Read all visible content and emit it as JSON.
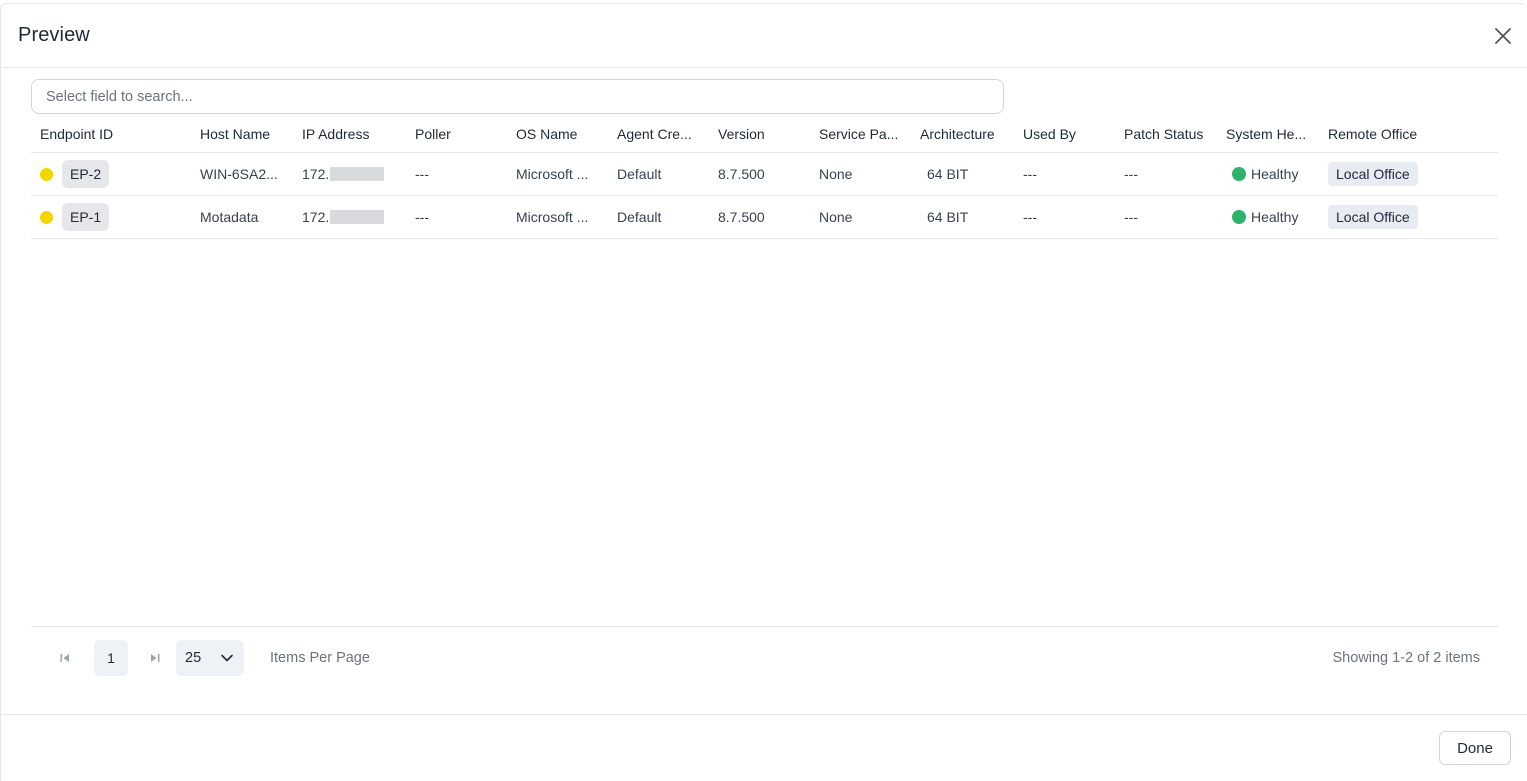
{
  "modal": {
    "title": "Preview",
    "close_icon": "close-icon"
  },
  "search": {
    "placeholder": "Select field to search..."
  },
  "table": {
    "columns": [
      "Endpoint ID",
      "Host Name",
      "IP Address",
      "Poller",
      "OS Name",
      "Agent Cre...",
      "Version",
      "Service Pa...",
      "Architecture",
      "Used By",
      "Patch Status",
      "System He...",
      "Remote Office"
    ],
    "rows": [
      {
        "endpoint_id": "EP-2",
        "status_color": "#f5d500",
        "host_name": "WIN-6SA2...",
        "ip_address": "172.",
        "poller": "---",
        "os_name": "Microsoft ...",
        "agent_cred": "Default",
        "version": "8.7.500",
        "service_pack": "None",
        "architecture": "64 BIT",
        "used_by": "---",
        "patch_status": "---",
        "system_health": "Healthy",
        "remote_office": "Local Office"
      },
      {
        "endpoint_id": "EP-1",
        "status_color": "#f5d500",
        "host_name": "Motadata",
        "ip_address": "172.",
        "poller": "---",
        "os_name": "Microsoft ...",
        "agent_cred": "Default",
        "version": "8.7.500",
        "service_pack": "None",
        "architecture": "64 BIT",
        "used_by": "---",
        "patch_status": "---",
        "system_health": "Healthy",
        "remote_office": "Local Office"
      }
    ]
  },
  "pagination": {
    "current_page": "1",
    "page_size": "25",
    "items_per_page_label": "Items Per Page",
    "summary": "Showing 1-2 of 2 items"
  },
  "footer": {
    "done_label": "Done"
  },
  "colors": {
    "warning_dot": "#f5d500",
    "healthy_dot": "#2fb36a",
    "badge_bg": "#e5e7eb"
  }
}
